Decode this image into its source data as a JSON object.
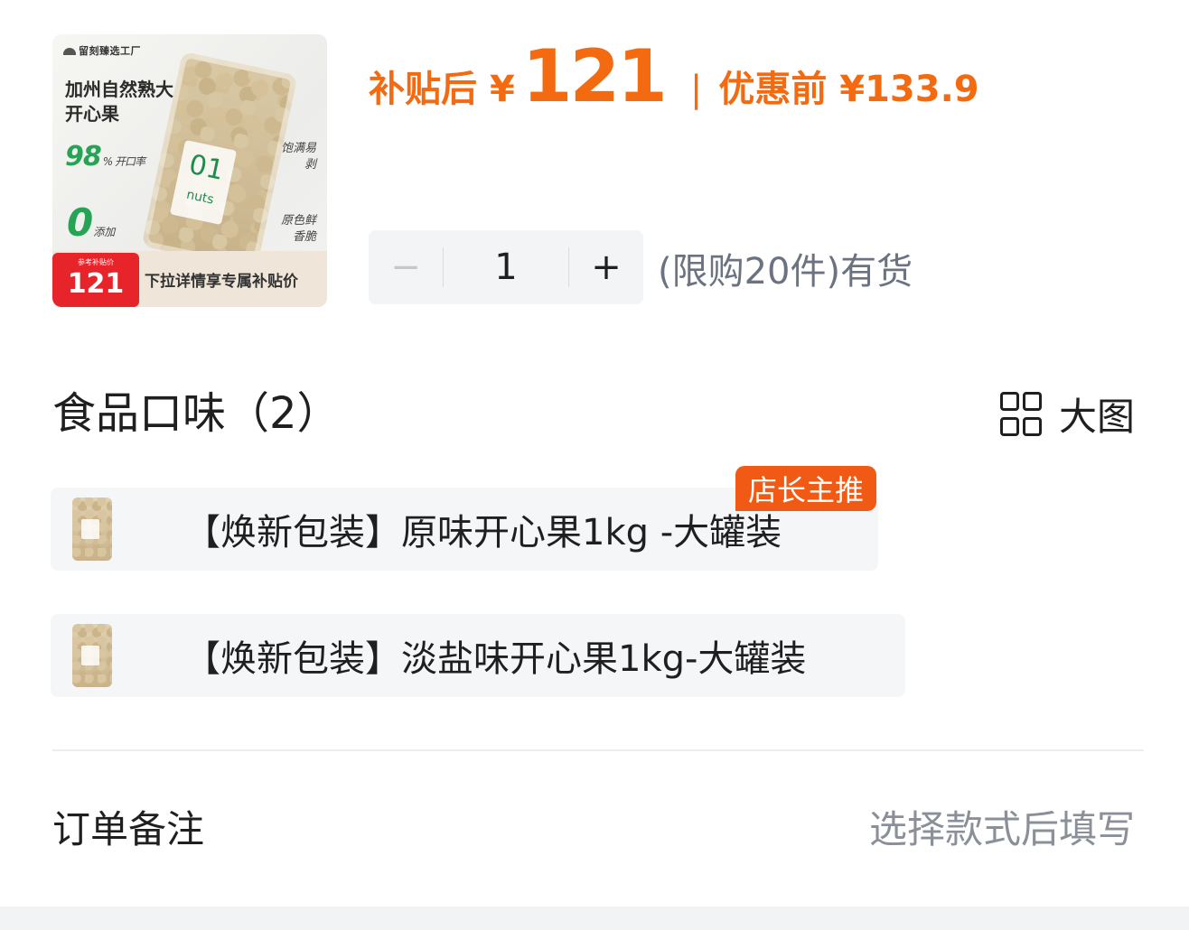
{
  "product": {
    "thumbnail": {
      "brand": "留刻臻选工厂",
      "title": "加州自然熟大开心果",
      "open_rate": "98",
      "open_rate_unit": "% 开口率",
      "zero": "0",
      "zero_label": "添加",
      "side_a": "饱满易剥",
      "side_b": "原色鲜香脆",
      "jar_label_main": "01",
      "jar_label_sub": "nuts",
      "badge_mini": "参考补贴价",
      "badge_price": "121",
      "cta": "下拉详情享专属补贴价"
    }
  },
  "price": {
    "after_label": "补贴后",
    "currency": "¥",
    "after_value": "121",
    "separator": "|",
    "before_text": "优惠前 ¥133.9",
    "color": "#f36a10"
  },
  "quantity": {
    "minus": "−",
    "value": "1",
    "plus": "+",
    "stock_text": "(限购20件)有货"
  },
  "flavor_section": {
    "title": "食品口味（2）",
    "view_toggle_label": "大图",
    "options": [
      {
        "label": "【焕新包装】原味开心果1kg -大罐装",
        "badge": "店长主推"
      },
      {
        "label": "【焕新包装】淡盐味开心果1kg-大罐装"
      }
    ]
  },
  "order_note": {
    "label": "订单备注",
    "hint": "选择款式后填写"
  },
  "icons": {
    "view_toggle": "grid-icon",
    "option_thumbnail": "product-thumbnail"
  }
}
